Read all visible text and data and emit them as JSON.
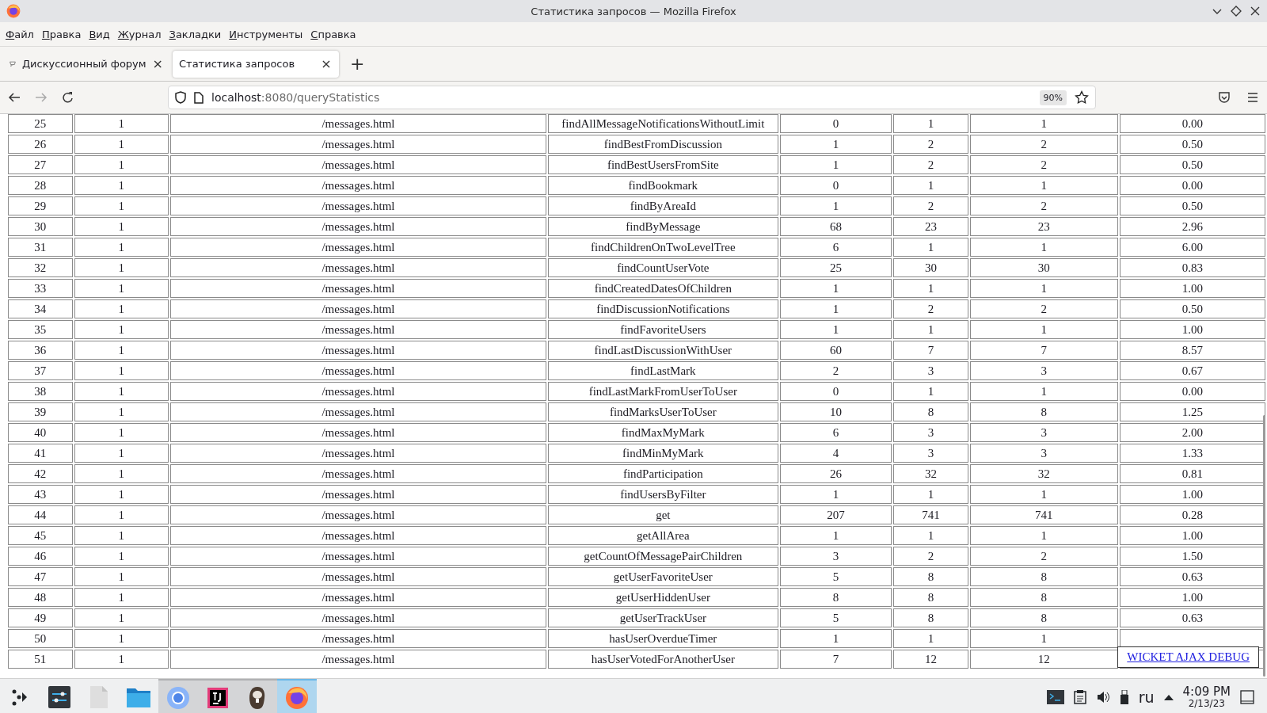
{
  "window": {
    "title": "Статистика запросов — Mozilla Firefox"
  },
  "menu": [
    "Файл",
    "Правка",
    "Вид",
    "Журнал",
    "Закладки",
    "Инструменты",
    "Справка"
  ],
  "tabs": [
    {
      "label": "Дискуссионный форум",
      "selected": false,
      "favicon": true,
      "close": "×"
    },
    {
      "label": "Статистика запросов",
      "selected": true,
      "favicon": false,
      "close": "×"
    }
  ],
  "new_tab": "+",
  "address": {
    "host": "localhost",
    "path": ":8080/queryStatistics",
    "zoom": "90%"
  },
  "table": {
    "rows": [
      [
        "25",
        "1",
        "/messages.html",
        "findAllMessageNotificationsWithoutLimit",
        "0",
        "1",
        "1",
        "0.00"
      ],
      [
        "26",
        "1",
        "/messages.html",
        "findBestFromDiscussion",
        "1",
        "2",
        "2",
        "0.50"
      ],
      [
        "27",
        "1",
        "/messages.html",
        "findBestUsersFromSite",
        "1",
        "2",
        "2",
        "0.50"
      ],
      [
        "28",
        "1",
        "/messages.html",
        "findBookmark",
        "0",
        "1",
        "1",
        "0.00"
      ],
      [
        "29",
        "1",
        "/messages.html",
        "findByAreaId",
        "1",
        "2",
        "2",
        "0.50"
      ],
      [
        "30",
        "1",
        "/messages.html",
        "findByMessage",
        "68",
        "23",
        "23",
        "2.96"
      ],
      [
        "31",
        "1",
        "/messages.html",
        "findChildrenOnTwoLevelTree",
        "6",
        "1",
        "1",
        "6.00"
      ],
      [
        "32",
        "1",
        "/messages.html",
        "findCountUserVote",
        "25",
        "30",
        "30",
        "0.83"
      ],
      [
        "33",
        "1",
        "/messages.html",
        "findCreatedDatesOfChildren",
        "1",
        "1",
        "1",
        "1.00"
      ],
      [
        "34",
        "1",
        "/messages.html",
        "findDiscussionNotifications",
        "1",
        "2",
        "2",
        "0.50"
      ],
      [
        "35",
        "1",
        "/messages.html",
        "findFavoriteUsers",
        "1",
        "1",
        "1",
        "1.00"
      ],
      [
        "36",
        "1",
        "/messages.html",
        "findLastDiscussionWithUser",
        "60",
        "7",
        "7",
        "8.57"
      ],
      [
        "37",
        "1",
        "/messages.html",
        "findLastMark",
        "2",
        "3",
        "3",
        "0.67"
      ],
      [
        "38",
        "1",
        "/messages.html",
        "findLastMarkFromUserToUser",
        "0",
        "1",
        "1",
        "0.00"
      ],
      [
        "39",
        "1",
        "/messages.html",
        "findMarksUserToUser",
        "10",
        "8",
        "8",
        "1.25"
      ],
      [
        "40",
        "1",
        "/messages.html",
        "findMaxMyMark",
        "6",
        "3",
        "3",
        "2.00"
      ],
      [
        "41",
        "1",
        "/messages.html",
        "findMinMyMark",
        "4",
        "3",
        "3",
        "1.33"
      ],
      [
        "42",
        "1",
        "/messages.html",
        "findParticipation",
        "26",
        "32",
        "32",
        "0.81"
      ],
      [
        "43",
        "1",
        "/messages.html",
        "findUsersByFilter",
        "1",
        "1",
        "1",
        "1.00"
      ],
      [
        "44",
        "1",
        "/messages.html",
        "get",
        "207",
        "741",
        "741",
        "0.28"
      ],
      [
        "45",
        "1",
        "/messages.html",
        "getAllArea",
        "1",
        "1",
        "1",
        "1.00"
      ],
      [
        "46",
        "1",
        "/messages.html",
        "getCountOfMessagePairChildren",
        "3",
        "2",
        "2",
        "1.50"
      ],
      [
        "47",
        "1",
        "/messages.html",
        "getUserFavoriteUser",
        "5",
        "8",
        "8",
        "0.63"
      ],
      [
        "48",
        "1",
        "/messages.html",
        "getUserHiddenUser",
        "8",
        "8",
        "8",
        "1.00"
      ],
      [
        "49",
        "1",
        "/messages.html",
        "getUserTrackUser",
        "5",
        "8",
        "8",
        "0.63"
      ],
      [
        "50",
        "1",
        "/messages.html",
        "hasUserOverdueTimer",
        "1",
        "1",
        "1"
      ],
      [
        "51",
        "1",
        "/messages.html",
        "hasUserVotedForAnotherUser",
        "7",
        "12",
        "12"
      ]
    ]
  },
  "debug_link": "WICKET AJAX DEBUG",
  "taskbar": {
    "apps": [
      {
        "kind": "launcher",
        "running": false,
        "selected": false
      },
      {
        "kind": "settings",
        "running": false,
        "selected": false
      },
      {
        "kind": "file",
        "running": false,
        "selected": false
      },
      {
        "kind": "folder",
        "running": false,
        "selected": false
      },
      {
        "kind": "chromium",
        "running": true,
        "selected": false
      },
      {
        "kind": "ide",
        "running": true,
        "selected": false
      },
      {
        "kind": "beaver",
        "running": true,
        "selected": false
      },
      {
        "kind": "firefox",
        "running": true,
        "selected": true
      }
    ],
    "language": "ru",
    "time": "4:09 PM",
    "date": "2/13/23"
  }
}
